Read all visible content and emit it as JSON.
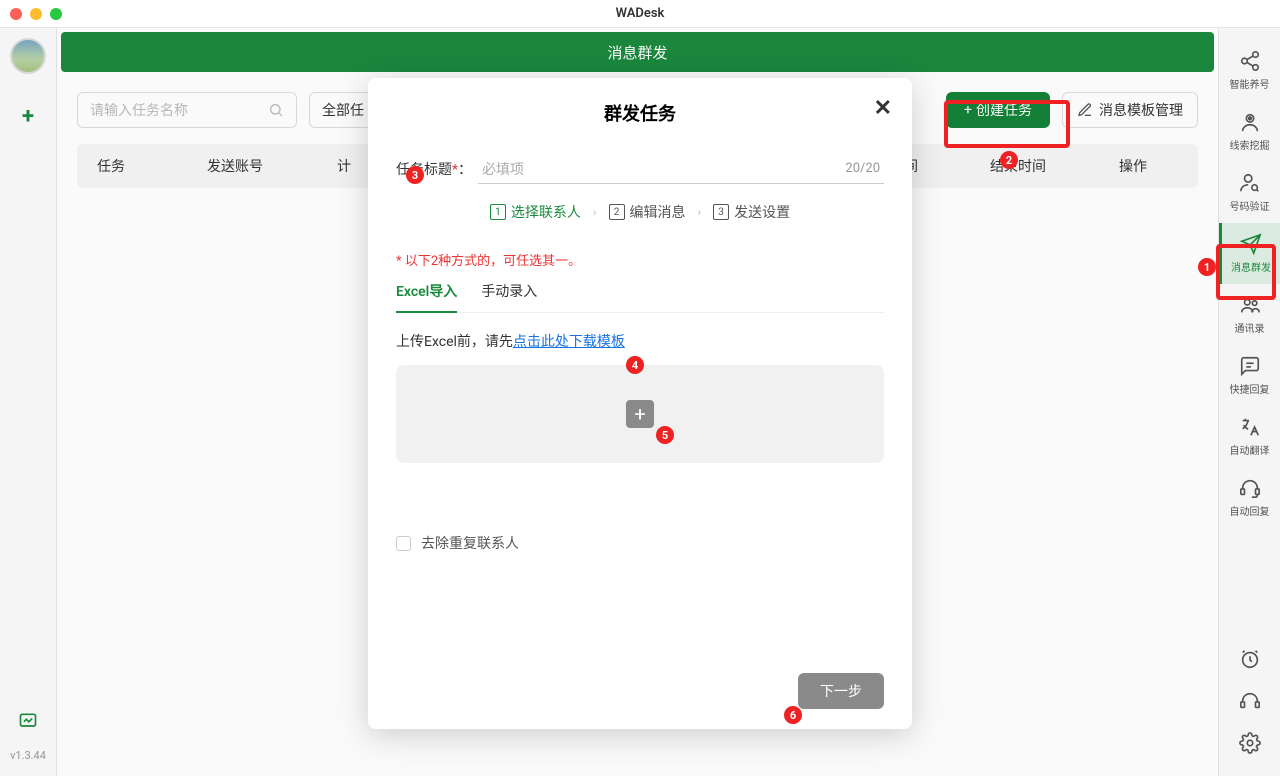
{
  "window": {
    "title": "WADesk"
  },
  "left_sidebar": {
    "version": "v1.3.44"
  },
  "page": {
    "header_title": "消息群发",
    "search_placeholder": "请输入任务名称",
    "filter_label": "全部任",
    "create_task_label": "创建任务",
    "template_mgmt_label": "消息模板管理",
    "columns": {
      "task": "任务",
      "account": "发送账号",
      "plan": "计",
      "time1": "时间",
      "time2": "结束时间",
      "ops": "操作"
    }
  },
  "right_sidebar": {
    "items": [
      {
        "id": "smart",
        "label": "智能养号"
      },
      {
        "id": "leads",
        "label": "线索挖掘"
      },
      {
        "id": "verify",
        "label": "号码验证"
      },
      {
        "id": "bulk",
        "label": "消息群发"
      },
      {
        "id": "contacts",
        "label": "通讯录"
      },
      {
        "id": "quick",
        "label": "快捷回复"
      },
      {
        "id": "translate",
        "label": "自动翻译"
      },
      {
        "id": "autoreply",
        "label": "自动回复"
      }
    ]
  },
  "modal": {
    "title": "群发任务",
    "task_title_label": "任务标题",
    "task_title_placeholder": "必填项",
    "task_title_counter": "20/20",
    "steps": {
      "s1": "选择联系人",
      "s2": "编辑消息",
      "s3": "发送设置"
    },
    "note": "* 以下2种方式的，可任选其一。",
    "tab_excel": "Excel导入",
    "tab_manual": "手动录入",
    "upload_prefix": "上传Excel前，请先",
    "upload_link": "点击此处下载模板",
    "dedupe_label": "去除重复联系人",
    "next_label": "下一步"
  },
  "badges": {
    "b1": "1",
    "b2": "2",
    "b3": "3",
    "b4": "4",
    "b5": "5",
    "b6": "6"
  }
}
